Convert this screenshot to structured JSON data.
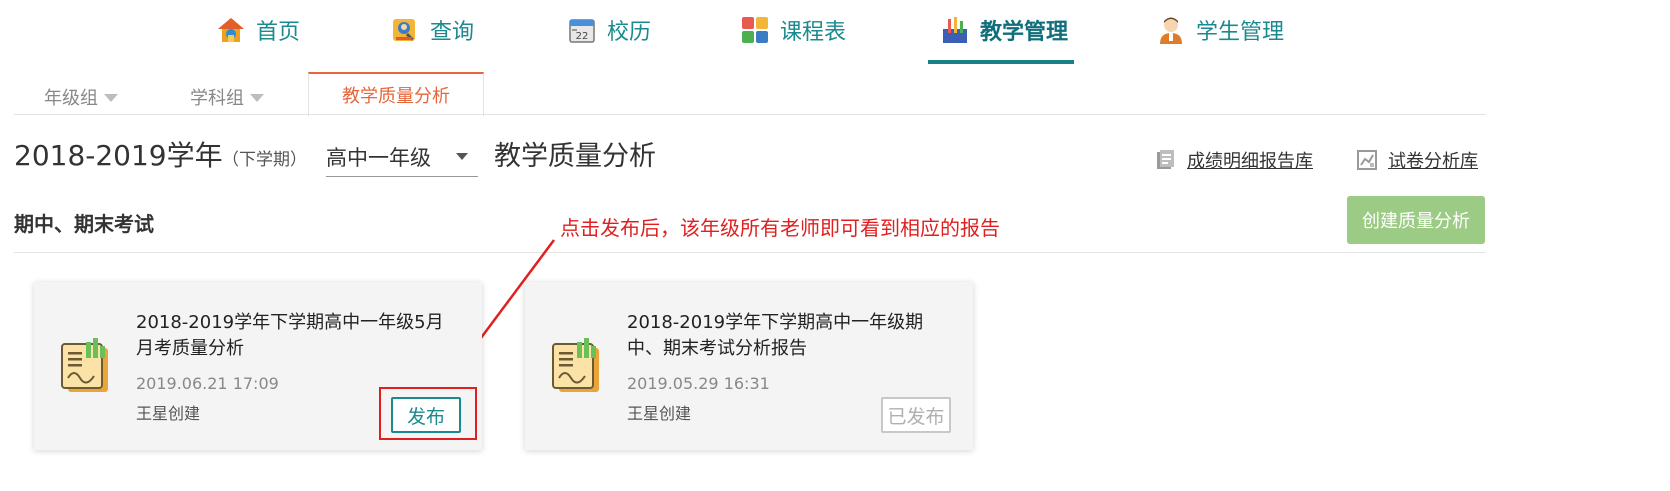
{
  "nav": {
    "items": [
      {
        "label": "首页",
        "icon": "home-icon"
      },
      {
        "label": "查询",
        "icon": "search-person-icon"
      },
      {
        "label": "校历",
        "icon": "calendar-icon"
      },
      {
        "label": "课程表",
        "icon": "timetable-icon"
      },
      {
        "label": "教学管理",
        "icon": "teaching-icon",
        "active": true
      },
      {
        "label": "学生管理",
        "icon": "student-icon"
      }
    ],
    "accent_color": "#1b8a8f"
  },
  "subtabs": {
    "items": [
      {
        "label": "年级组"
      },
      {
        "label": "学科组"
      },
      {
        "label": "教学质量分析",
        "active": true
      }
    ],
    "active_color": "#e8663b"
  },
  "header": {
    "year": "2018-2019学年",
    "term": "（下学期）",
    "grade_selected": "高中一年级",
    "page_title": "教学质量分析",
    "links": [
      {
        "label": "成绩明细报告库",
        "icon": "report-library-icon"
      },
      {
        "label": "试卷分析库",
        "icon": "paper-analysis-icon"
      }
    ]
  },
  "section": {
    "title": "期中、期末考试",
    "create_button": "创建质量分析",
    "create_button_color": "#9ccb85"
  },
  "annotation": {
    "text": "点击发布后，该年级所有老师即可看到相应的报告",
    "color": "#e02020"
  },
  "cards": [
    {
      "title": "2018-2019学年下学期高中一年级5月月考质量分析",
      "date": "2019.06.21 17:09",
      "author": "王星创建",
      "action": "发布",
      "published": false
    },
    {
      "title": "2018-2019学年下学期高中一年级期中、期末考试分析报告",
      "date": "2019.05.29 16:31",
      "author": "王星创建",
      "action": "已发布",
      "published": true
    }
  ]
}
